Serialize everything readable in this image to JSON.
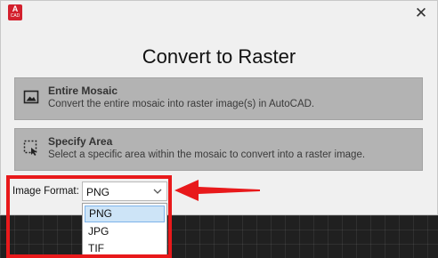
{
  "window": {
    "app_icon_text": "A",
    "app_icon_subtext": "CAD",
    "close_glyph": "✕"
  },
  "dialog": {
    "title": "Convert to Raster",
    "options": [
      {
        "title": "Entire Mosaic",
        "description": "Convert the entire mosaic into raster image(s) in AutoCAD.",
        "icon": "image-icon"
      },
      {
        "title": "Specify Area",
        "description": "Select a specific area within the mosaic to convert into a raster image.",
        "icon": "area-select-icon"
      }
    ],
    "image_format": {
      "label": "Image Format:",
      "selected": "PNG",
      "options": [
        "PNG",
        "JPG",
        "TIF"
      ]
    }
  },
  "colors": {
    "app_icon": "#d3202d",
    "annotation_red": "#e8191b",
    "option_bg": "#b3b3b3",
    "dropdown_highlight": "#cde4f7"
  }
}
